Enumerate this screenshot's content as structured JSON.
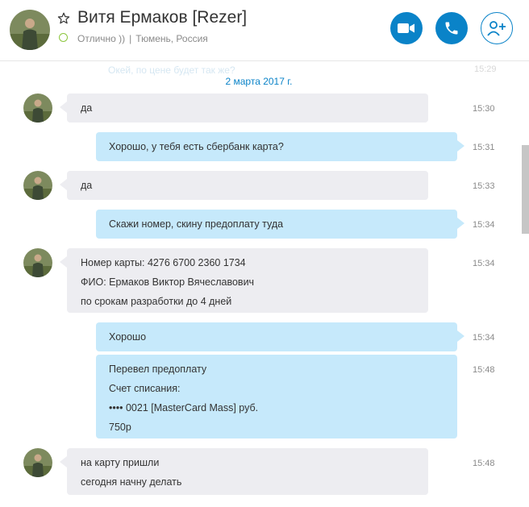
{
  "header": {
    "contact_name": "Витя Ермаков [Rezer]",
    "mood": "Отлично ))",
    "separator": "|",
    "location": "Тюмень, Россия",
    "presence_color": "#8cc63e",
    "accent_color": "#0a83c8",
    "buttons": [
      {
        "name": "video-call-button",
        "icon": "video-camera-icon"
      },
      {
        "name": "audio-call-button",
        "icon": "phone-icon"
      },
      {
        "name": "add-people-button",
        "icon": "add-person-icon"
      }
    ]
  },
  "conversation": {
    "partial_message": "Окей, по цене будет так же?",
    "partial_time": "15:29",
    "date_separator": "2 марта 2017 г.",
    "messages": [
      {
        "direction": "in",
        "lines": [
          "да"
        ],
        "time": "15:30"
      },
      {
        "direction": "out",
        "lines": [
          "Хорошо, у тебя есть сбербанк карта?"
        ],
        "time": "15:31"
      },
      {
        "direction": "in",
        "lines": [
          "да"
        ],
        "time": "15:33"
      },
      {
        "direction": "out",
        "lines": [
          "Скажи номер, скину предоплату туда"
        ],
        "time": "15:34"
      },
      {
        "direction": "in",
        "lines": [
          "Номер карты: 4276 6700 2360 1734",
          "ФИО: Ермаков Виктор Вячеславович",
          "по срокам разработки до 4 дней"
        ],
        "time": "15:34"
      },
      {
        "direction": "out",
        "lines": [
          "Хорошо"
        ],
        "time": "15:34"
      },
      {
        "direction": "out",
        "lines": [
          "Перевел предоплату",
          "Счет списания:",
          "•••• 0021  [MasterCard Mass]  руб.",
          "750р"
        ],
        "time": "15:48"
      },
      {
        "direction": "in",
        "lines": [
          "на карту пришли",
          "сегодня начну делать"
        ],
        "time": "15:48"
      }
    ]
  },
  "colors": {
    "incoming_bubble": "#ededf1",
    "outgoing_bubble": "#c6e9fb",
    "timestamp": "#8a8a8a"
  }
}
